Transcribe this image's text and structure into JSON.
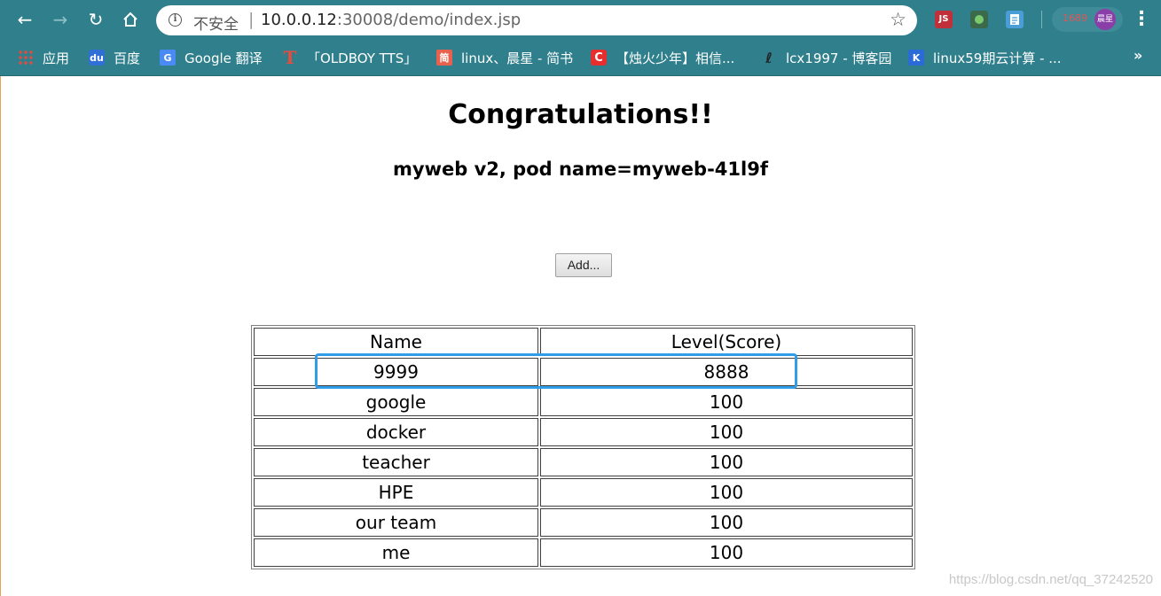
{
  "browser": {
    "omnibox": {
      "security_label": "不安全",
      "separator": "|",
      "url_host": "10.0.0.12",
      "url_rest": ":30008/demo/index.jsp"
    },
    "extensions": [
      {
        "name": "js-extension-icon",
        "label": "JS"
      },
      {
        "name": "evernote-extension-icon",
        "label": ""
      },
      {
        "name": "docs-extension-icon",
        "label": ""
      }
    ],
    "profile": {
      "label": "1689",
      "avatar_text": "晨星"
    }
  },
  "bookmarks": [
    {
      "label": "应用",
      "icon": "apps-icon"
    },
    {
      "label": "百度",
      "icon": "baidu-icon"
    },
    {
      "label": "Google 翻译",
      "icon": "google-translate-icon"
    },
    {
      "label": "「OLDBOY TTS」",
      "icon": "tts-icon"
    },
    {
      "label": "linux、晨星 - 简书",
      "icon": "jianshu-icon"
    },
    {
      "label": "【烛火少年】相信...",
      "icon": "csdn-icon"
    },
    {
      "label": "lcx1997 - 博客园",
      "icon": "cnblogs-icon"
    },
    {
      "label": "linux59期云计算 - ...",
      "icon": "k-icon"
    }
  ],
  "page": {
    "title": "Congratulations!!",
    "subtitle": "myweb v2, pod name=myweb-41l9f",
    "add_button_label": "Add...",
    "table": {
      "headers": [
        "Name",
        "Level(Score)"
      ],
      "rows": [
        [
          "9999",
          "8888"
        ],
        [
          "google",
          "100"
        ],
        [
          "docker",
          "100"
        ],
        [
          "teacher",
          "100"
        ],
        [
          "HPE",
          "100"
        ],
        [
          "our team",
          "100"
        ],
        [
          "me",
          "100"
        ]
      ]
    },
    "highlight_color": "#2f9de8",
    "watermark": "https://blog.csdn.net/qq_37242520"
  }
}
